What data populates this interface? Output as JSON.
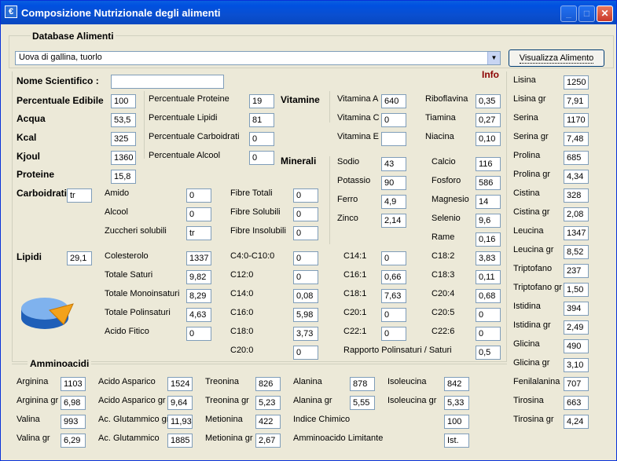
{
  "window": {
    "title": "Composizione Nutrizionale degli alimenti",
    "app_icon": "food-app-icon",
    "controls": {
      "minimize": "_",
      "maximize": "□",
      "close": "✕"
    }
  },
  "database": {
    "group_label": "Database Alimenti",
    "selected": "Uova di gallina, tuorlo",
    "button_label": "Visualizza Alimento",
    "info_label": "Info"
  },
  "general": {
    "nome_scientifico": {
      "label": "Nome Scientifico :",
      "value": ""
    },
    "percentuale_edibile": {
      "label": "Percentuale Edibile",
      "value": "100"
    },
    "acqua": {
      "label": "Acqua",
      "value": "53,5"
    },
    "kcal": {
      "label": "Kcal",
      "value": "325"
    },
    "kjoul": {
      "label": "Kjoul",
      "value": "1360"
    },
    "proteine": {
      "label": "Proteine",
      "value": "15,8"
    },
    "perc_proteine": {
      "label": "Percentuale Proteine",
      "value": "19"
    },
    "perc_lipidi": {
      "label": "Percentuale Lipidi",
      "value": "81"
    },
    "perc_carboidrati": {
      "label": "Percentuale Carboidrati",
      "value": "0"
    },
    "perc_alcool": {
      "label": "Percentuale Alcool",
      "value": "0"
    }
  },
  "vitamine": {
    "title": "Vitamine",
    "items": [
      {
        "label": "Vitamina A",
        "value": "640"
      },
      {
        "label": "Vitamina C",
        "value": "0"
      },
      {
        "label": "Vitamina E",
        "value": ""
      },
      {
        "label": "Riboflavina",
        "value": "0,35"
      },
      {
        "label": "Tiamina",
        "value": "0,27"
      },
      {
        "label": "Niacina",
        "value": "0,10"
      }
    ]
  },
  "minerali": {
    "title": "Minerali",
    "items": [
      {
        "label": "Sodio",
        "value": "43"
      },
      {
        "label": "Potassio",
        "value": "90"
      },
      {
        "label": "Ferro",
        "value": "4,9"
      },
      {
        "label": "Zinco",
        "value": "2,14"
      },
      {
        "label": "Calcio",
        "value": "116"
      },
      {
        "label": "Fosforo",
        "value": "586"
      },
      {
        "label": "Magnesio",
        "value": "14"
      },
      {
        "label": "Selenio",
        "value": "9,6"
      },
      {
        "label": "Rame",
        "value": "0,16"
      }
    ]
  },
  "carboidrati": {
    "label": "Carboidrati",
    "value": "tr",
    "items": [
      {
        "label": "Amido",
        "value": "0"
      },
      {
        "label": "Alcool",
        "value": "0"
      },
      {
        "label": "Zuccheri solubili",
        "value": "tr"
      },
      {
        "label": "Fibre Totali",
        "value": "0"
      },
      {
        "label": "Fibre Solubili",
        "value": "0"
      },
      {
        "label": "Fibre Insolubili",
        "value": "0"
      }
    ]
  },
  "lipidi": {
    "label": "Lipidi",
    "value": "29,1",
    "items": [
      {
        "label": "Colesterolo",
        "value": "1337"
      },
      {
        "label": "Totale Saturi",
        "value": "9,82"
      },
      {
        "label": "Totale Monoinsaturi",
        "value": "8,29"
      },
      {
        "label": "Totale Polinsaturi",
        "value": "4,63"
      },
      {
        "label": "Acido Fitico",
        "value": "0"
      },
      {
        "label": "C4:0-C10:0",
        "value": "0"
      },
      {
        "label": "C12:0",
        "value": "0"
      },
      {
        "label": "C14:0",
        "value": "0,08"
      },
      {
        "label": "C16:0",
        "value": "5,98"
      },
      {
        "label": "C18:0",
        "value": "3,73"
      },
      {
        "label": "C20:0",
        "value": "0"
      },
      {
        "label": "C14:1",
        "value": "0"
      },
      {
        "label": "C16:1",
        "value": "0,66"
      },
      {
        "label": "C18:1",
        "value": "7,63"
      },
      {
        "label": "C20:1",
        "value": "0"
      },
      {
        "label": "C22:1",
        "value": "0"
      },
      {
        "label": "C18:2",
        "value": "3,83"
      },
      {
        "label": "C18:3",
        "value": "0,11"
      },
      {
        "label": "C20:4",
        "value": "0,68"
      },
      {
        "label": "C20:5",
        "value": "0"
      },
      {
        "label": "C22:6",
        "value": "0"
      },
      {
        "label": "Rapporto Polinsaturi / Saturi",
        "value": "0,5"
      }
    ]
  },
  "amminoacidi_right": [
    {
      "label": "Lisina",
      "value": "1250"
    },
    {
      "label": "Lisina gr",
      "value": "7,91"
    },
    {
      "label": "Serina",
      "value": "1170"
    },
    {
      "label": "Serina gr",
      "value": "7,48"
    },
    {
      "label": "Prolina",
      "value": "685"
    },
    {
      "label": "Prolina gr",
      "value": "4,34"
    },
    {
      "label": "Cistina",
      "value": "328"
    },
    {
      "label": "Cistina gr",
      "value": "2,08"
    },
    {
      "label": "Leucina",
      "value": "1347"
    },
    {
      "label": "Leucina gr",
      "value": "8,52"
    },
    {
      "label": "Triptofano",
      "value": "237"
    },
    {
      "label": "Triptofano gr",
      "value": "1,50"
    },
    {
      "label": "Istidina",
      "value": "394"
    },
    {
      "label": "Istidina gr",
      "value": "2,49"
    },
    {
      "label": "Glicina",
      "value": "490"
    },
    {
      "label": "Glicina gr",
      "value": "3,10"
    },
    {
      "label": "Fenilalanina",
      "value": "707"
    },
    {
      "label": "Tirosina",
      "value": "663"
    },
    {
      "label": "Tirosina gr",
      "value": "4,24"
    }
  ],
  "amminoacidi": {
    "title": "Amminoacidi",
    "items": [
      {
        "label": "Arginina",
        "value": "1103"
      },
      {
        "label": "Arginina gr",
        "value": "6,98"
      },
      {
        "label": "Valina",
        "value": "993"
      },
      {
        "label": "Valina gr",
        "value": "6,29"
      },
      {
        "label": "Acido Asparico",
        "value": "1524"
      },
      {
        "label": "Acido Asparico gr",
        "value": "9,64"
      },
      {
        "label": "Ac. Glutammico gr",
        "value": "11,93"
      },
      {
        "label": "Ac. Glutammico",
        "value": "1885"
      },
      {
        "label": "Treonina",
        "value": "826"
      },
      {
        "label": "Treonina gr",
        "value": "5,23"
      },
      {
        "label": "Metionina",
        "value": "422"
      },
      {
        "label": "Metionina gr",
        "value": "2,67"
      },
      {
        "label": "Alanina",
        "value": "878"
      },
      {
        "label": "Alanina gr",
        "value": "5,55"
      },
      {
        "label": "Isoleucina",
        "value": "842"
      },
      {
        "label": "Isoleucina gr",
        "value": "5,33"
      },
      {
        "label": "Indice Chimico",
        "value": "100"
      },
      {
        "label": "Amminoacido Limitante",
        "value": "Ist."
      }
    ]
  }
}
